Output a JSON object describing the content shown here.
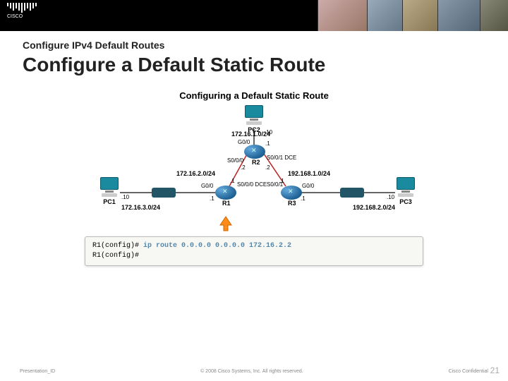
{
  "banner": {
    "brand": "CISCO"
  },
  "slide": {
    "eyebrow": "Configure IPv4 Default Routes",
    "title": "Configure a Default Static Route",
    "diagram_title": "Configuring a Default Static Route"
  },
  "pcs": {
    "pc1": "PC1",
    "pc2": "PC2",
    "pc3": "PC3"
  },
  "routers": {
    "r1": "R1",
    "r2": "R2",
    "r3": "R3"
  },
  "subnets": {
    "pc2_lan": "172.16.1.0/24",
    "r1_r2": "172.16.2.0/24",
    "r2_r3": "192.168.1.0/24",
    "pc1_lan": "172.16.3.0/24",
    "pc3_lan": "192.168.2.0/24"
  },
  "ifs": {
    "r2_g00": "G0/0",
    "r2_g00_ip": ".1",
    "r2_s000": "S0/0/0",
    "r2_s000_ip": ".2",
    "r2_s001": "S0/0/1 DCE",
    "r2_s001_ip": ".2",
    "r1_s000": "S0/0/0 DCE",
    "r1_s000_ip": ".1",
    "r3_s001": "S0/0/1",
    "r3_s001_ip": ".1",
    "r1_g00": "G0/0",
    "r1_g00_ip": ".1",
    "r3_g00": "G0/0",
    "r3_g00_ip": ".1",
    "pc1_ip": ".10",
    "pc2_ip": ".10",
    "pc3_ip": ".10"
  },
  "terminal": {
    "prompt1": "R1(config)# ",
    "command": "ip route 0.0.0.0 0.0.0.0 172.16.2.2",
    "prompt2": "R1(config)#"
  },
  "footer": {
    "left": "Presentation_ID",
    "center": "© 2008 Cisco Systems, Inc. All rights reserved.",
    "right": "Cisco Confidential",
    "page": "21"
  }
}
